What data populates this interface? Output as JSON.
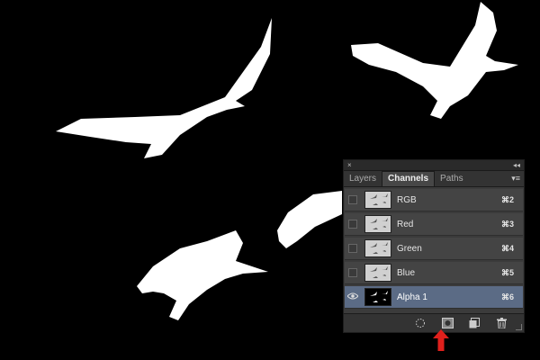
{
  "panel": {
    "close_glyph": "×",
    "collapse_glyph": "◂◂",
    "menu_glyph": "▾≡",
    "tabs": [
      {
        "label": "Layers",
        "active": false
      },
      {
        "label": "Channels",
        "active": true
      },
      {
        "label": "Paths",
        "active": false
      }
    ],
    "channels": [
      {
        "name": "RGB",
        "shortcut": "⌘2",
        "visible": false,
        "selected": false,
        "thumb": "light"
      },
      {
        "name": "Red",
        "shortcut": "⌘3",
        "visible": false,
        "selected": false,
        "thumb": "light"
      },
      {
        "name": "Green",
        "shortcut": "⌘4",
        "visible": false,
        "selected": false,
        "thumb": "light"
      },
      {
        "name": "Blue",
        "shortcut": "⌘5",
        "visible": false,
        "selected": false,
        "thumb": "light"
      },
      {
        "name": "Alpha 1",
        "shortcut": "⌘6",
        "visible": true,
        "selected": true,
        "thumb": "dark"
      }
    ],
    "bottom_buttons": [
      {
        "icon": "load-selection-icon"
      },
      {
        "icon": "save-selection-as-channel-icon"
      },
      {
        "icon": "new-channel-icon"
      },
      {
        "icon": "trash-icon"
      }
    ]
  },
  "colors": {
    "canvas": "#000000",
    "panel_bg": "#3b3b3b",
    "selected_row": "#5b6b85",
    "annotation_arrow": "#e0201c"
  }
}
